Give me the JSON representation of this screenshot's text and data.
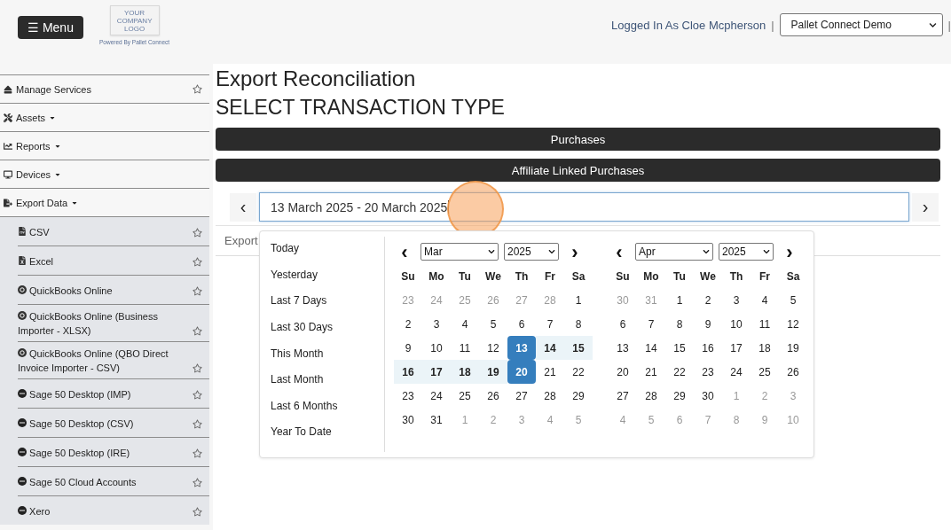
{
  "header": {
    "menu_button": "☰ Menu",
    "logo_lines": [
      "YOUR",
      "COMPANY",
      "LOGO"
    ],
    "powered_by": "Powered By Pallet Connect",
    "logged_in": "Logged In As Cloe Mcpherson",
    "separator_left": "|",
    "company_select": "Pallet Connect Demo",
    "separator_right": "|"
  },
  "sidebar": {
    "items": [
      {
        "label": "Manage Services",
        "kind": "link"
      },
      {
        "label": "Assets",
        "kind": "dropdown"
      },
      {
        "label": "Reports",
        "kind": "dropdown"
      },
      {
        "label": "Devices",
        "kind": "dropdown"
      },
      {
        "label": "Export Data",
        "kind": "dropdown",
        "expanded": true,
        "children": [
          {
            "label": "CSV"
          },
          {
            "label": "Excel"
          },
          {
            "label": "QuickBooks Online"
          },
          {
            "label": "QuickBooks Online (Business Importer - XLSX)"
          },
          {
            "label": "QuickBooks Online (QBO Direct Invoice Importer - CSV)"
          },
          {
            "label": "Sage 50 Desktop (IMP)"
          },
          {
            "label": "Sage 50 Desktop (CSV)"
          },
          {
            "label": "Sage 50 Desktop (IRE)"
          },
          {
            "label": "Sage 50 Cloud Accounts"
          },
          {
            "label": "Xero"
          }
        ]
      }
    ]
  },
  "main": {
    "title": "Export Reconciliation",
    "subtitle": "SELECT TRANSACTION TYPE",
    "buttons": [
      "Purchases",
      "Affiliate Linked Purchases"
    ],
    "date_range": {
      "prev": "‹",
      "value": "13 March 2025 - 20 March 2025",
      "next": "›"
    },
    "tab_label": "Export",
    "picker": {
      "ranges": [
        "Today",
        "Yesterday",
        "Last 7 Days",
        "Last 30 Days",
        "This Month",
        "Last Month",
        "Last 6 Months",
        "Year To Date"
      ],
      "calendars": [
        {
          "prev": "‹",
          "month": "Mar",
          "year": "2025",
          "weekdays": [
            "Su",
            "Mo",
            "Tu",
            "We",
            "Th",
            "Fr",
            "Sa"
          ],
          "weeks": [
            [
              {
                "label": "23",
                "muted": true,
                "in_range": false,
                "selected": false
              },
              {
                "label": "24",
                "muted": true,
                "in_range": false,
                "selected": false
              },
              {
                "label": "25",
                "muted": true,
                "in_range": false,
                "selected": false
              },
              {
                "label": "26",
                "muted": true,
                "in_range": false,
                "selected": false
              },
              {
                "label": "27",
                "muted": true,
                "in_range": false,
                "selected": false
              },
              {
                "label": "28",
                "muted": true,
                "in_range": false,
                "selected": false
              },
              {
                "label": "1",
                "muted": false,
                "in_range": false,
                "selected": false
              }
            ],
            [
              {
                "label": "2",
                "muted": false,
                "in_range": false,
                "selected": false
              },
              {
                "label": "3",
                "muted": false,
                "in_range": false,
                "selected": false
              },
              {
                "label": "4",
                "muted": false,
                "in_range": false,
                "selected": false
              },
              {
                "label": "5",
                "muted": false,
                "in_range": false,
                "selected": false
              },
              {
                "label": "6",
                "muted": false,
                "in_range": false,
                "selected": false
              },
              {
                "label": "7",
                "muted": false,
                "in_range": false,
                "selected": false
              },
              {
                "label": "8",
                "muted": false,
                "in_range": false,
                "selected": false
              }
            ],
            [
              {
                "label": "9",
                "muted": false,
                "in_range": false,
                "selected": false
              },
              {
                "label": "10",
                "muted": false,
                "in_range": false,
                "selected": false
              },
              {
                "label": "11",
                "muted": false,
                "in_range": false,
                "selected": false
              },
              {
                "label": "12",
                "muted": false,
                "in_range": false,
                "selected": false
              },
              {
                "label": "13",
                "muted": false,
                "in_range": true,
                "selected": true
              },
              {
                "label": "14",
                "muted": false,
                "in_range": true,
                "selected": false
              },
              {
                "label": "15",
                "muted": false,
                "in_range": true,
                "selected": false
              }
            ],
            [
              {
                "label": "16",
                "muted": false,
                "in_range": true,
                "selected": false
              },
              {
                "label": "17",
                "muted": false,
                "in_range": true,
                "selected": false
              },
              {
                "label": "18",
                "muted": false,
                "in_range": true,
                "selected": false
              },
              {
                "label": "19",
                "muted": false,
                "in_range": true,
                "selected": false
              },
              {
                "label": "20",
                "muted": false,
                "in_range": true,
                "selected": true
              },
              {
                "label": "21",
                "muted": false,
                "in_range": false,
                "selected": false
              },
              {
                "label": "22",
                "muted": false,
                "in_range": false,
                "selected": false
              }
            ],
            [
              {
                "label": "23",
                "muted": false,
                "in_range": false,
                "selected": false
              },
              {
                "label": "24",
                "muted": false,
                "in_range": false,
                "selected": false
              },
              {
                "label": "25",
                "muted": false,
                "in_range": false,
                "selected": false
              },
              {
                "label": "26",
                "muted": false,
                "in_range": false,
                "selected": false
              },
              {
                "label": "27",
                "muted": false,
                "in_range": false,
                "selected": false
              },
              {
                "label": "28",
                "muted": false,
                "in_range": false,
                "selected": false
              },
              {
                "label": "29",
                "muted": false,
                "in_range": false,
                "selected": false
              }
            ],
            [
              {
                "label": "30",
                "muted": false,
                "in_range": false,
                "selected": false
              },
              {
                "label": "31",
                "muted": false,
                "in_range": false,
                "selected": false
              },
              {
                "label": "1",
                "muted": true,
                "in_range": false,
                "selected": false
              },
              {
                "label": "2",
                "muted": true,
                "in_range": false,
                "selected": false
              },
              {
                "label": "3",
                "muted": true,
                "in_range": false,
                "selected": false
              },
              {
                "label": "4",
                "muted": true,
                "in_range": false,
                "selected": false
              },
              {
                "label": "5",
                "muted": true,
                "in_range": false,
                "selected": false
              }
            ]
          ],
          "next": "›"
        },
        {
          "prev": "‹",
          "month": "Apr",
          "year": "2025",
          "weekdays": [
            "Su",
            "Mo",
            "Tu",
            "We",
            "Th",
            "Fr",
            "Sa"
          ],
          "weeks": [
            [
              {
                "label": "30",
                "muted": true,
                "in_range": false,
                "selected": false
              },
              {
                "label": "31",
                "muted": true,
                "in_range": false,
                "selected": false
              },
              {
                "label": "1",
                "muted": false,
                "in_range": false,
                "selected": false
              },
              {
                "label": "2",
                "muted": false,
                "in_range": false,
                "selected": false
              },
              {
                "label": "3",
                "muted": false,
                "in_range": false,
                "selected": false
              },
              {
                "label": "4",
                "muted": false,
                "in_range": false,
                "selected": false
              },
              {
                "label": "5",
                "muted": false,
                "in_range": false,
                "selected": false
              }
            ],
            [
              {
                "label": "6",
                "muted": false,
                "in_range": false,
                "selected": false
              },
              {
                "label": "7",
                "muted": false,
                "in_range": false,
                "selected": false
              },
              {
                "label": "8",
                "muted": false,
                "in_range": false,
                "selected": false
              },
              {
                "label": "9",
                "muted": false,
                "in_range": false,
                "selected": false
              },
              {
                "label": "10",
                "muted": false,
                "in_range": false,
                "selected": false
              },
              {
                "label": "11",
                "muted": false,
                "in_range": false,
                "selected": false
              },
              {
                "label": "12",
                "muted": false,
                "in_range": false,
                "selected": false
              }
            ],
            [
              {
                "label": "13",
                "muted": false,
                "in_range": false,
                "selected": false
              },
              {
                "label": "14",
                "muted": false,
                "in_range": false,
                "selected": false
              },
              {
                "label": "15",
                "muted": false,
                "in_range": false,
                "selected": false
              },
              {
                "label": "16",
                "muted": false,
                "in_range": false,
                "selected": false
              },
              {
                "label": "17",
                "muted": false,
                "in_range": false,
                "selected": false
              },
              {
                "label": "18",
                "muted": false,
                "in_range": false,
                "selected": false
              },
              {
                "label": "19",
                "muted": false,
                "in_range": false,
                "selected": false
              }
            ],
            [
              {
                "label": "20",
                "muted": false,
                "in_range": false,
                "selected": false
              },
              {
                "label": "21",
                "muted": false,
                "in_range": false,
                "selected": false
              },
              {
                "label": "22",
                "muted": false,
                "in_range": false,
                "selected": false
              },
              {
                "label": "23",
                "muted": false,
                "in_range": false,
                "selected": false
              },
              {
                "label": "24",
                "muted": false,
                "in_range": false,
                "selected": false
              },
              {
                "label": "25",
                "muted": false,
                "in_range": false,
                "selected": false
              },
              {
                "label": "26",
                "muted": false,
                "in_range": false,
                "selected": false
              }
            ],
            [
              {
                "label": "27",
                "muted": false,
                "in_range": false,
                "selected": false
              },
              {
                "label": "28",
                "muted": false,
                "in_range": false,
                "selected": false
              },
              {
                "label": "29",
                "muted": false,
                "in_range": false,
                "selected": false
              },
              {
                "label": "30",
                "muted": false,
                "in_range": false,
                "selected": false
              },
              {
                "label": "1",
                "muted": true,
                "in_range": false,
                "selected": false
              },
              {
                "label": "2",
                "muted": true,
                "in_range": false,
                "selected": false
              },
              {
                "label": "3",
                "muted": true,
                "in_range": false,
                "selected": false
              }
            ],
            [
              {
                "label": "4",
                "muted": true,
                "in_range": false,
                "selected": false
              },
              {
                "label": "5",
                "muted": true,
                "in_range": false,
                "selected": false
              },
              {
                "label": "6",
                "muted": true,
                "in_range": false,
                "selected": false
              },
              {
                "label": "7",
                "muted": true,
                "in_range": false,
                "selected": false
              },
              {
                "label": "8",
                "muted": true,
                "in_range": false,
                "selected": false
              },
              {
                "label": "9",
                "muted": true,
                "in_range": false,
                "selected": false
              },
              {
                "label": "10",
                "muted": true,
                "in_range": false,
                "selected": false
              }
            ]
          ],
          "next": "›"
        }
      ]
    }
  }
}
